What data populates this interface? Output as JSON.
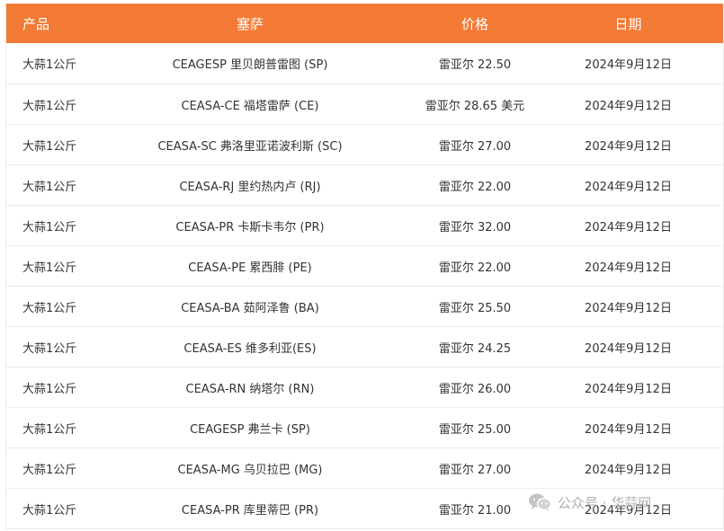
{
  "table": {
    "headers": [
      "产品",
      "塞萨",
      "价格",
      "日期"
    ],
    "rows": [
      [
        "大蒜1公斤",
        "CEAGESP 里贝朗普雷图 (SP)",
        "雷亚尔 22.50",
        "2024年9月12日"
      ],
      [
        "大蒜1公斤",
        "CEASA-CE 福塔雷萨 (CE)",
        "雷亚尔 28.65 美元",
        "2024年9月12日"
      ],
      [
        "大蒜1公斤",
        "CEASA-SC 弗洛里亚诺波利斯 (SC)",
        "雷亚尔 27.00",
        "2024年9月12日"
      ],
      [
        "大蒜1公斤",
        "CEASA-RJ 里约热内卢 (RJ)",
        "雷亚尔 22.00",
        "2024年9月12日"
      ],
      [
        "大蒜1公斤",
        "CEASA-PR 卡斯卡韦尔 (PR)",
        "雷亚尔 32.00",
        "2024年9月12日"
      ],
      [
        "大蒜1公斤",
        "CEASA-PE 累西腓 (PE)",
        "雷亚尔 22.00",
        "2024年9月12日"
      ],
      [
        "大蒜1公斤",
        "CEASA-BA 茹阿泽鲁 (BA)",
        "雷亚尔 25.50",
        "2024年9月12日"
      ],
      [
        "大蒜1公斤",
        "CEASA-ES 维多利亚(ES)",
        "雷亚尔 24.25",
        "2024年9月12日"
      ],
      [
        "大蒜1公斤",
        "CEASA-RN 纳塔尔 (RN)",
        "雷亚尔 26.00",
        "2024年9月12日"
      ],
      [
        "大蒜1公斤",
        "CEAGESP 弗兰卡 (SP)",
        "雷亚尔 25.00",
        "2024年9月12日"
      ],
      [
        "大蒜1公斤",
        "CEASA-MG 乌贝拉巴 (MG)",
        "雷亚尔 27.00",
        "2024年9月12日"
      ],
      [
        "大蒜1公斤",
        "CEASA-PR 库里蒂巴 (PR)",
        "雷亚尔 21.00",
        "2024年9月12日"
      ]
    ]
  },
  "watermark": {
    "icon": "wechat-icon",
    "channel": "公众号 · 华蒜网"
  },
  "colors": {
    "header_bg": "#f27a35",
    "header_text": "#ffffff",
    "row_border": "#ececec",
    "body_text": "#333333"
  }
}
